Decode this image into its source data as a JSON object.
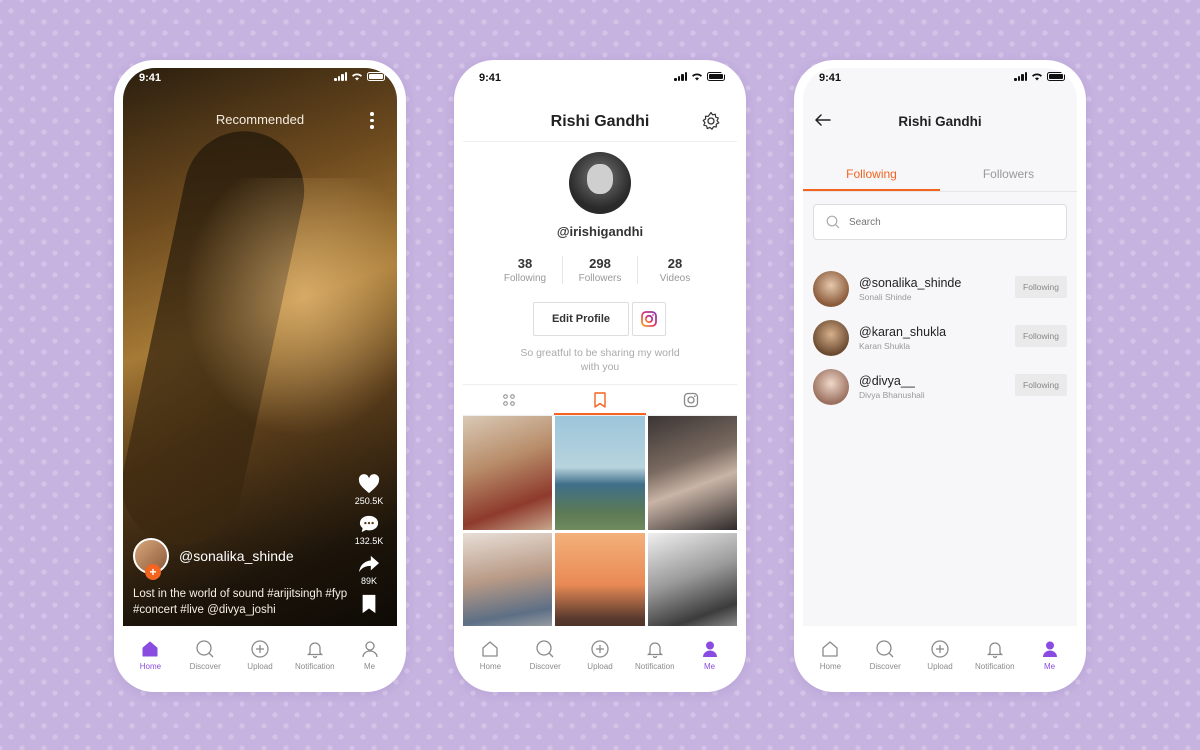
{
  "colors": {
    "accent_orange": "#f2641f",
    "accent_purple": "#8a4be0",
    "background": "#c6b3e0"
  },
  "status_time": "9:41",
  "screen1": {
    "header_title": "Recommended",
    "likes": "250.5K",
    "comments": "132.5K",
    "shares": "89K",
    "username": "@sonalika_shinde",
    "caption": "Lost in the world of sound #arijitsingh #fyp #concert #live  @divya_joshi",
    "follow_plus": "+"
  },
  "screen2": {
    "title": "Rishi Gandhi",
    "handle": "@irishigandhi",
    "stats": [
      {
        "value": "38",
        "label": "Following"
      },
      {
        "value": "298",
        "label": "Followers"
      },
      {
        "value": "28",
        "label": "Videos"
      }
    ],
    "edit_profile": "Edit Profile",
    "bio": "So greatful to be sharing my world with you"
  },
  "screen3": {
    "title": "Rishi Gandhi",
    "tabs": [
      "Following",
      "Followers"
    ],
    "search_placeholder": "Search",
    "users": [
      {
        "handle": "@sonalika_shinde",
        "name": "Sonali Shinde",
        "button": "Following"
      },
      {
        "handle": "@karan_shukla",
        "name": "Karan Shukla",
        "button": "Following"
      },
      {
        "handle": "@divya__",
        "name": "Divya Bhanushali",
        "button": "Following"
      }
    ]
  },
  "tabbar": {
    "home": "Home",
    "discover": "Discover",
    "upload": "Upload",
    "notification": "Notification",
    "me": "Me"
  }
}
